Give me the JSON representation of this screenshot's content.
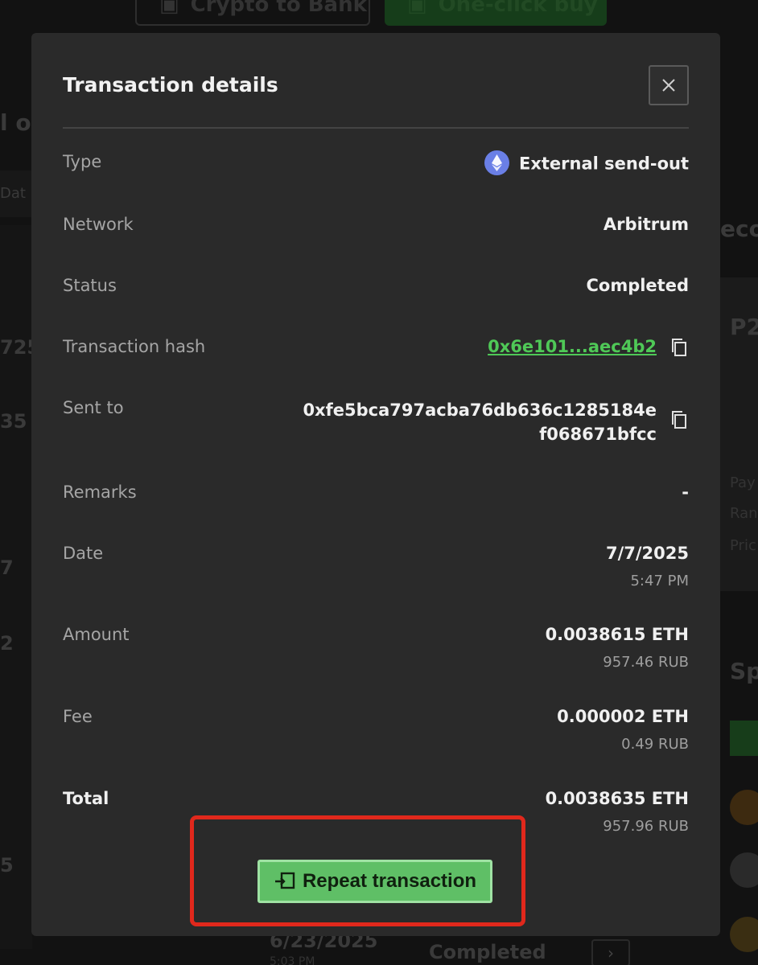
{
  "background": {
    "buttons": [
      "Crypto to Bank",
      "One-click buy"
    ],
    "left_fragments": [
      "l o",
      "Dat",
      "725",
      "35",
      "7",
      "2",
      "5"
    ],
    "right_fragments": [
      "eco",
      "P2",
      "Pay",
      "Ran",
      "Pric",
      "Sp"
    ],
    "bottom_row": {
      "date": "6/23/2025",
      "time": "5:03 PM",
      "status": "Completed"
    }
  },
  "modal": {
    "title": "Transaction details",
    "close_icon": "close-icon",
    "rows": {
      "type": {
        "label": "Type",
        "value": "External send-out",
        "icon": "ethereum-icon"
      },
      "network": {
        "label": "Network",
        "value": "Arbitrum"
      },
      "status": {
        "label": "Status",
        "value": "Completed"
      },
      "hash": {
        "label": "Transaction hash",
        "value": "0x6e101...aec4b2"
      },
      "sent_to": {
        "label": "Sent to",
        "line1": "0xfe5bca797acba76db636c1285184e",
        "line2": "f068671bfcc"
      },
      "remarks": {
        "label": "Remarks",
        "value": "-"
      },
      "date": {
        "label": "Date",
        "value": "7/7/2025",
        "sub": "5:47 PM"
      },
      "amount": {
        "label": "Amount",
        "value": "0.0038615 ETH",
        "sub": "957.46 RUB"
      },
      "fee": {
        "label": "Fee",
        "value": "0.000002 ETH",
        "sub": "0.49 RUB"
      },
      "total": {
        "label": "Total",
        "value": "0.0038635 ETH",
        "sub": "957.96 RUB"
      }
    },
    "repeat_button": "Repeat transaction",
    "colors": {
      "accent_green": "#4fc957",
      "button_green": "#5fbf66",
      "highlight_red": "#e0281c"
    }
  }
}
